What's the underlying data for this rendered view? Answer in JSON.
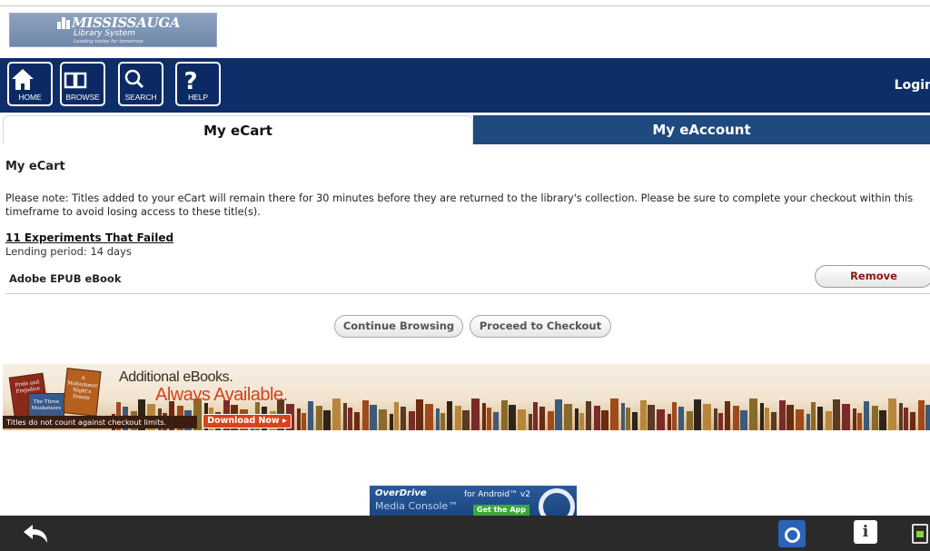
{
  "logo": {
    "name": "MISSISSAUGA",
    "subtitle": "Library System",
    "tagline": "Leading today for tomorrow"
  },
  "nav": {
    "buttons": [
      {
        "label": "HOME",
        "icon": "home-icon"
      },
      {
        "label": "BROWSE",
        "icon": "book-icon"
      },
      {
        "label": "SEARCH",
        "icon": "search-icon"
      },
      {
        "label": "HELP",
        "icon": "question-icon"
      }
    ],
    "login": "Login"
  },
  "tabs": {
    "cart": "My eCart",
    "account": "My eAccount",
    "active": "cart"
  },
  "section_title": "My eCart",
  "note": "Please note: Titles added to your eCart will remain there for 30 minutes before they are returned to the library's collection. Please be sure to complete your checkout within this timeframe to avoid losing access to these title(s).",
  "cart_item": {
    "title": "11 Experiments That Failed",
    "lending": "Lending period: 14 days",
    "format": "Adobe EPUB eBook",
    "remove_label": "Remove"
  },
  "actions": {
    "continue": "Continue Browsing",
    "checkout": "Proceed to Checkout"
  },
  "banner": {
    "line1": "Additional eBooks.",
    "line2": "Always Available.",
    "note": "Titles do not count against checkout limits.",
    "button": "Download Now ▸",
    "books": [
      "Pride and Prejudice",
      "A Midsummer Night's Dream",
      "The Three Musketeers"
    ]
  },
  "od_ad": {
    "brand": "OverDrive",
    "product": "Media Console™",
    "platform": "for Android™ v2",
    "cta": "Get the App"
  },
  "system_bar": {
    "info_glyph": "i"
  },
  "colors": {
    "nav_bg": "#0e2e6a",
    "tab_inactive": "#1f4a7f",
    "remove_text": "#8a1414",
    "banner_accent": "#d0431d"
  }
}
